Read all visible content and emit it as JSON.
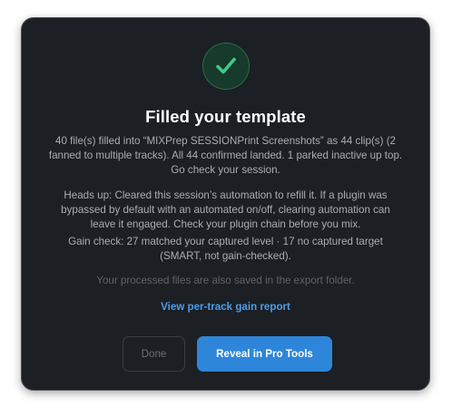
{
  "dialog": {
    "icon": "checkmark-icon",
    "title": "Filled your template",
    "summary": "40 file(s) filled into “MIXPrep SESSIONPrint Screenshots” as 44 clip(s) (2 fanned to multiple tracks). All 44 confirmed landed. 1 parked inactive up top. Go check your session.",
    "warning": "Heads up: Cleared this session’s automation to refill it. If a plugin was bypassed by default with an automated on/off, clearing automation can leave it engaged. Check your plugin chain before you mix.",
    "gain_check": "Gain check: 27 matched your captured level · 17 no captured target (SMART, not gain-checked).",
    "export_note": "Your processed files are also saved in the export folder.",
    "report_link": "View per-track gain report",
    "done_label": "Done",
    "reveal_label": "Reveal in Pro Tools"
  },
  "colors": {
    "background": "#1c1f24",
    "accent": "#2e86da",
    "link": "#4d9de6",
    "success": "#3fc98a"
  }
}
